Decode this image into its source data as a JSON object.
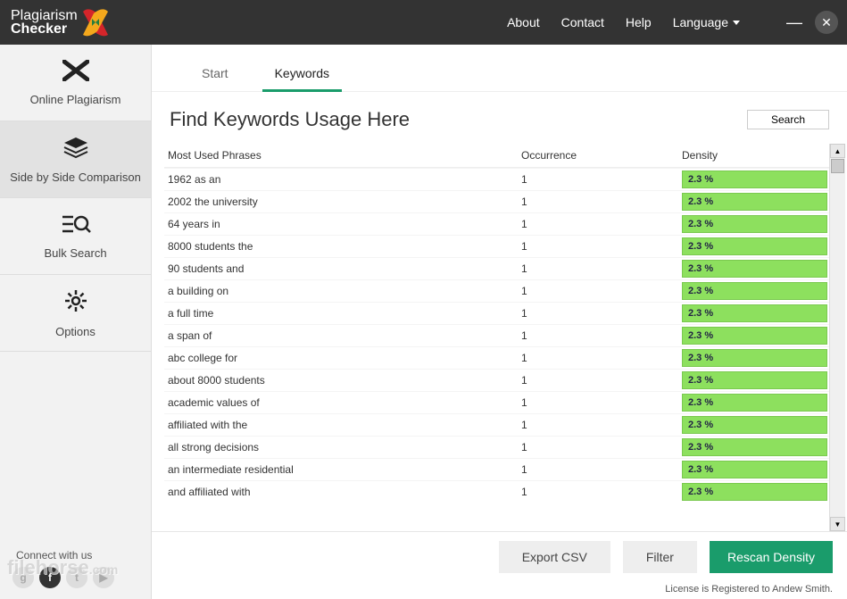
{
  "titlebar": {
    "logo_line1": "Plagiarism",
    "logo_line2": "Checker",
    "menu": {
      "about": "About",
      "contact": "Contact",
      "help": "Help",
      "language": "Language"
    }
  },
  "sidebar": {
    "items": [
      {
        "label": "Online Plagiarism"
      },
      {
        "label": "Side by Side Comparison"
      },
      {
        "label": "Bulk Search"
      },
      {
        "label": "Options"
      }
    ],
    "connect_label": "Connect with us",
    "watermark": "filehorse",
    "watermark_suffix": ".com"
  },
  "tabs": {
    "start": "Start",
    "keywords": "Keywords"
  },
  "heading": "Find Keywords Usage Here",
  "search_label": "Search",
  "table": {
    "headers": {
      "phrase": "Most Used Phrases",
      "occurrence": "Occurrence",
      "density": "Density"
    },
    "rows": [
      {
        "phrase": "1962 as an",
        "occurrence": "1",
        "density": "2.3 %"
      },
      {
        "phrase": "2002 the university",
        "occurrence": "1",
        "density": "2.3 %"
      },
      {
        "phrase": "64 years in",
        "occurrence": "1",
        "density": "2.3 %"
      },
      {
        "phrase": "8000 students the",
        "occurrence": "1",
        "density": "2.3 %"
      },
      {
        "phrase": "90 students and",
        "occurrence": "1",
        "density": "2.3 %"
      },
      {
        "phrase": "a building on",
        "occurrence": "1",
        "density": "2.3 %"
      },
      {
        "phrase": "a full time",
        "occurrence": "1",
        "density": "2.3 %"
      },
      {
        "phrase": "a span of",
        "occurrence": "1",
        "density": "2.3 %"
      },
      {
        "phrase": "abc college for",
        "occurrence": "1",
        "density": "2.3 %"
      },
      {
        "phrase": "about 8000 students",
        "occurrence": "1",
        "density": "2.3 %"
      },
      {
        "phrase": "academic values of",
        "occurrence": "1",
        "density": "2.3 %"
      },
      {
        "phrase": "affiliated with the",
        "occurrence": "1",
        "density": "2.3 %"
      },
      {
        "phrase": "all strong decisions",
        "occurrence": "1",
        "density": "2.3 %"
      },
      {
        "phrase": "an intermediate residential",
        "occurrence": "1",
        "density": "2.3 %"
      },
      {
        "phrase": "and affiliated with",
        "occurrence": "1",
        "density": "2.3 %"
      }
    ]
  },
  "footer": {
    "export": "Export CSV",
    "filter": "Filter",
    "rescan": "Rescan Density"
  },
  "license": "License is Registered to Andew Smith."
}
